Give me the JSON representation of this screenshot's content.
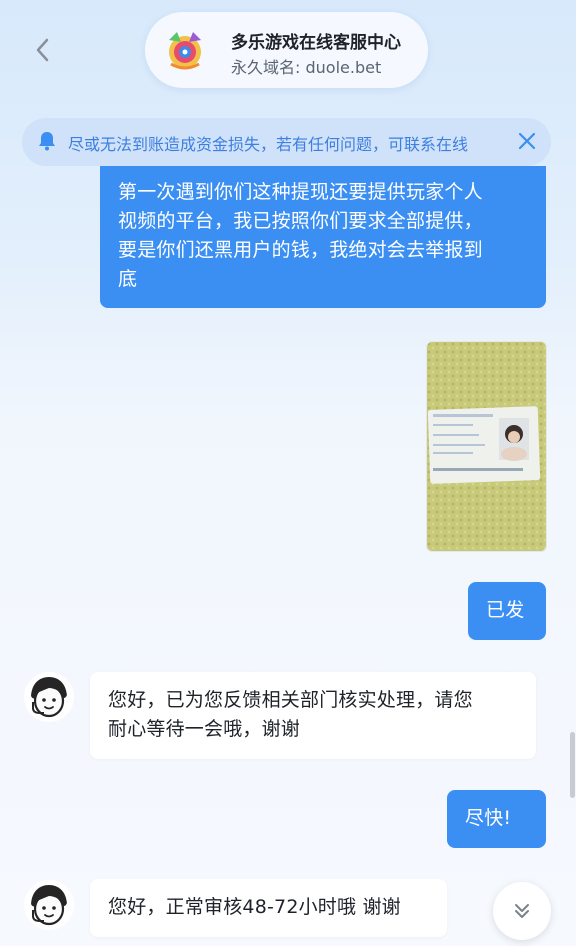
{
  "header": {
    "title": "多乐游戏在线客服中心",
    "domain": "永久域名: duole.bet"
  },
  "notice": {
    "text": "尽或无法到账造成资金损失，若有任何问题，可联系在线"
  },
  "messages": [
    {
      "from": "user",
      "type": "text",
      "lines": [
        "第一次遇到你们这种提现还要提供玩家个人",
        "视频的平台，我已按照你们要求全部提供，",
        "要是你们还黑用户的钱，我绝对会去举报到",
        "底"
      ]
    },
    {
      "from": "user",
      "type": "image"
    },
    {
      "from": "user",
      "type": "text",
      "lines": [
        "已发"
      ]
    },
    {
      "from": "agent",
      "type": "text",
      "lines": [
        "您好，已为您反馈相关部门核实处理，请您",
        "耐心等待一会哦，谢谢"
      ]
    },
    {
      "from": "user",
      "type": "text",
      "lines": [
        "尽快!"
      ]
    },
    {
      "from": "agent",
      "type": "text",
      "lines": [
        "您好，正常审核48-72小时哦 谢谢"
      ]
    }
  ],
  "colors": {
    "user_bubble": "#3b8ff3",
    "agent_bubble": "#ffffff",
    "notice_text": "#3d7fe0"
  },
  "icons": [
    "back-arrow-icon",
    "bell-icon",
    "close-icon",
    "chevron-double-down-icon",
    "agent-avatar-icon"
  ]
}
